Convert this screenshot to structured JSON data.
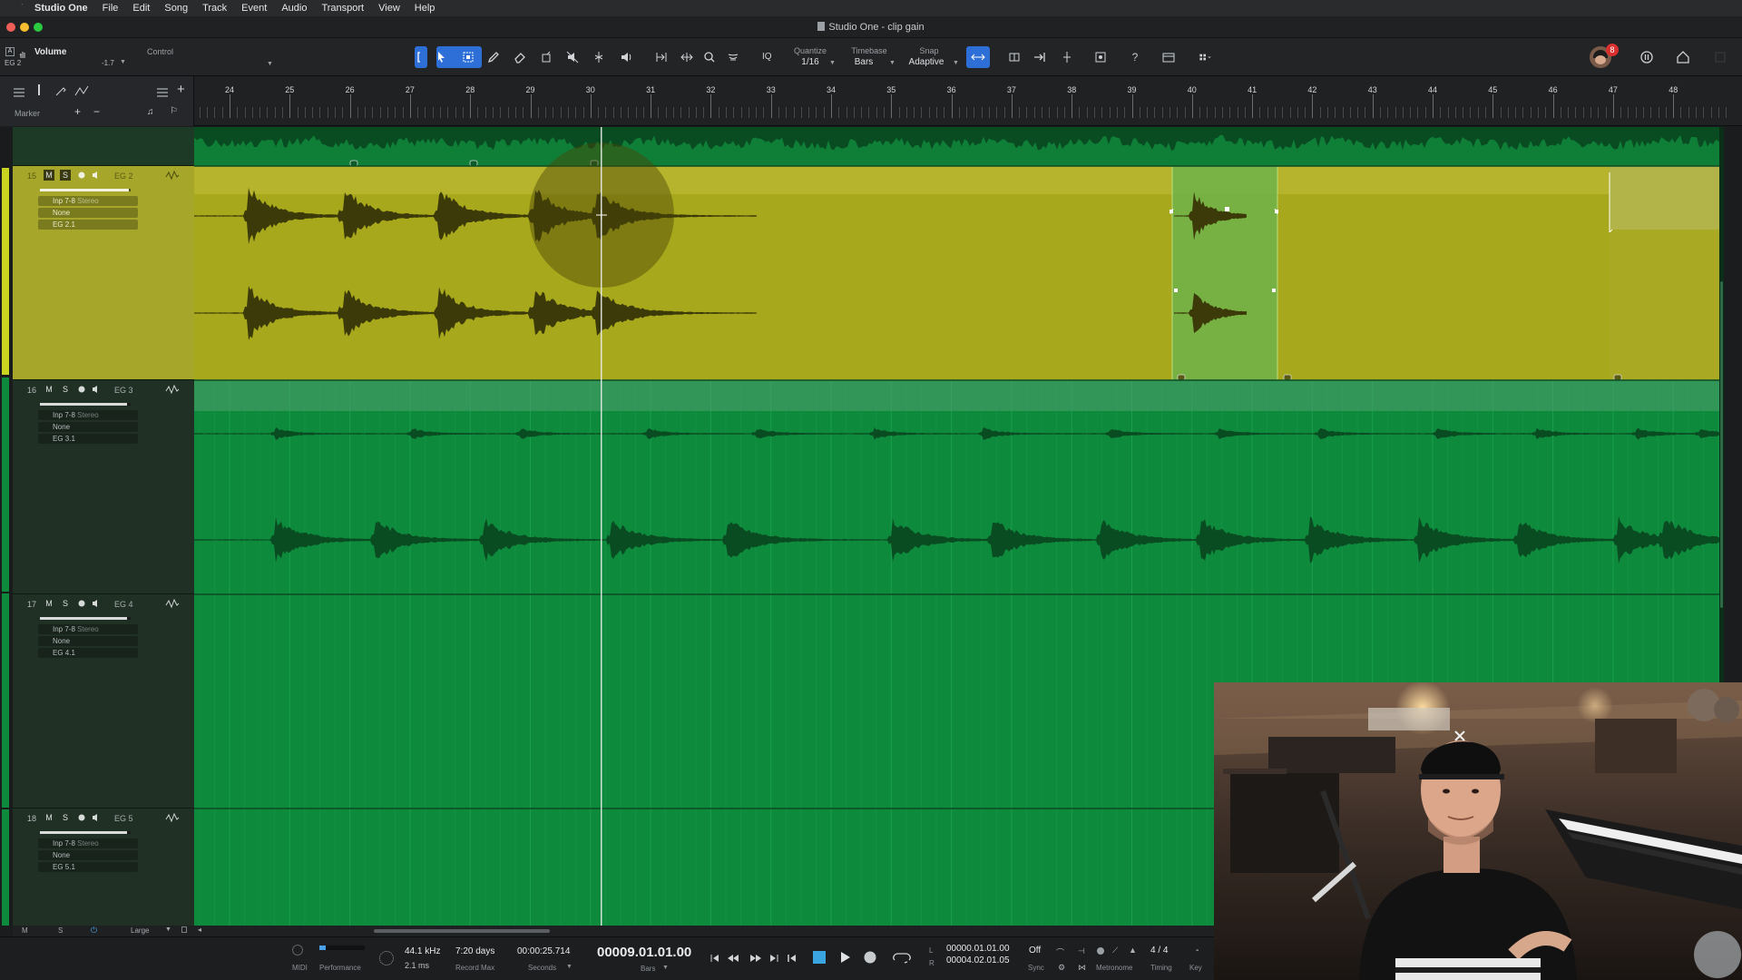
{
  "menubar": {
    "app_name": "Studio One",
    "items": [
      "File",
      "Edit",
      "Song",
      "Track",
      "Event",
      "Audio",
      "Transport",
      "View",
      "Help"
    ]
  },
  "window": {
    "title": "Studio One - clip gain"
  },
  "inspector": {
    "param_label": "Volume",
    "track_label": "EG 2",
    "value": "-1.7",
    "control_label": "Control"
  },
  "toolbar": {
    "iq_label": "IQ",
    "quantize_label": "Quantize",
    "quantize_value": "1/16",
    "timebase_label": "Timebase",
    "timebase_value": "Bars",
    "snap_label": "Snap",
    "snap_value": "Adaptive",
    "help_glyph": "?",
    "notification_count": "8"
  },
  "ruler": {
    "marker_label": "Marker",
    "bars": [
      "24",
      "25",
      "26",
      "27",
      "28",
      "29",
      "30",
      "31",
      "32",
      "33",
      "34",
      "35",
      "36",
      "37",
      "38",
      "39",
      "40",
      "41",
      "42",
      "43",
      "44",
      "45",
      "46",
      "47",
      "48"
    ]
  },
  "tracks": [
    {
      "number": "15",
      "name": "EG 2",
      "input": "Inp 7-8",
      "mode": "Stereo",
      "output_a": "None",
      "output_b": "EG 2.1",
      "m": "M",
      "s": "S",
      "selected": true
    },
    {
      "number": "16",
      "name": "EG 3",
      "input": "Inp 7-8",
      "mode": "Stereo",
      "output_a": "None",
      "output_b": "EG 3.1",
      "m": "M",
      "s": "S",
      "selected": false
    },
    {
      "number": "17",
      "name": "EG 4",
      "input": "Inp 7-8",
      "mode": "Stereo",
      "output_a": "None",
      "output_b": "EG 4.1",
      "m": "M",
      "s": "S",
      "selected": false
    },
    {
      "number": "18",
      "name": "EG 5",
      "input": "Inp 7-8",
      "mode": "Stereo",
      "output_a": "None",
      "output_b": "EG 5.1",
      "m": "M",
      "s": "S",
      "selected": false
    }
  ],
  "bottom_strip": {
    "m": "M",
    "s": "S",
    "size": "Large"
  },
  "transport": {
    "midi_label": "MIDI",
    "performance_label": "Performance",
    "sample_rate": "44.1 kHz",
    "latency": "2.1 ms",
    "record_days": "7:20 days",
    "record_max_label": "Record Max",
    "seconds_value": "00:00:25.714",
    "seconds_label": "Seconds",
    "position": "00009.01.01.00",
    "position_unit": "Bars",
    "loop_l_label": "L",
    "loop_r_label": "R",
    "loop_start": "00000.01.01.00",
    "loop_end": "00004.02.01.05",
    "sync_value": "Off",
    "sync_label": "Sync",
    "metronome_label": "Metronome",
    "timing_value": "4 / 4",
    "timing_label": "Timing",
    "key_value": "-",
    "key_label": "Key"
  },
  "colors": {
    "track_green": "#0e8a3c",
    "selected_clip": "#a8a81c",
    "selection_range": "#6fb34a",
    "transport_stop": "#3aa5e0",
    "accent_blue": "#2d6fd6"
  }
}
